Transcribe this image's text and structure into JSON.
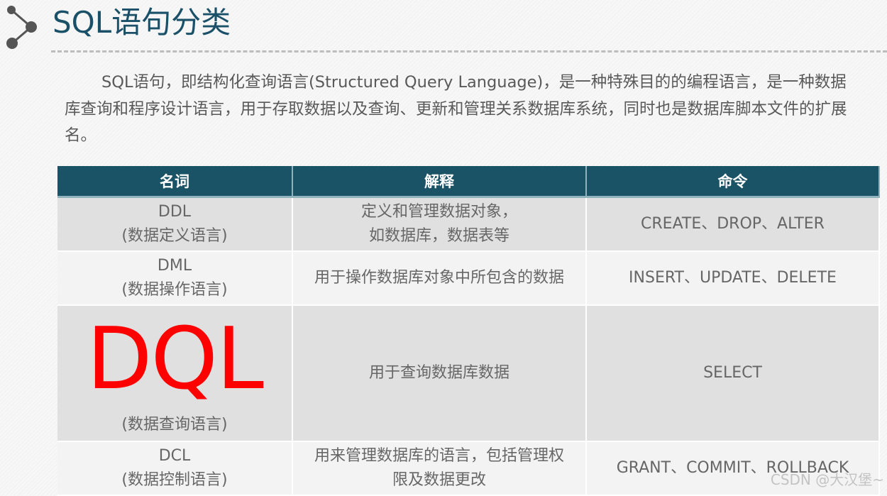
{
  "header": {
    "title": "SQL语句分类",
    "icon": "share-node-icon",
    "title_color": "#1a5068"
  },
  "intro": {
    "text": "SQL语句，即结构化查询语言(Structured Query Language)，是一种特殊目的的编程语言，是一种数据库查询和程序设计语言，用于存取数据以及查询、更新和管理关系数据库系统，同时也是数据库脚本文件的扩展名。"
  },
  "table": {
    "header_color": "#1a5266",
    "highlight_color": "#ff0000",
    "columns": [
      "名词",
      "解释",
      "命令"
    ],
    "rows": [
      {
        "term": "DDL",
        "term_sub": "(数据定义语言)",
        "explain_lines": [
          "定义和管理数据对象，",
          "如数据库，数据表等"
        ],
        "commands": "CREATE、DROP、ALTER"
      },
      {
        "term": "DML",
        "term_sub": "(数据操作语言)",
        "explain_lines": [
          "用于操作数据库对象中所包含的数据"
        ],
        "commands": "INSERT、UPDATE、DELETE"
      },
      {
        "term": "DQL",
        "term_sub": "(数据查询语言)",
        "explain_lines": [
          "用于查询数据库数据"
        ],
        "commands": "SELECT"
      },
      {
        "term": "DCL",
        "term_sub": "(数据控制语言)",
        "explain_lines": [
          "用来管理数据库的语言，包括管理权",
          "限及数据更改"
        ],
        "commands": "GRANT、COMMIT、ROLLBACK"
      }
    ]
  },
  "watermark": "CSDN @大汉堡~"
}
